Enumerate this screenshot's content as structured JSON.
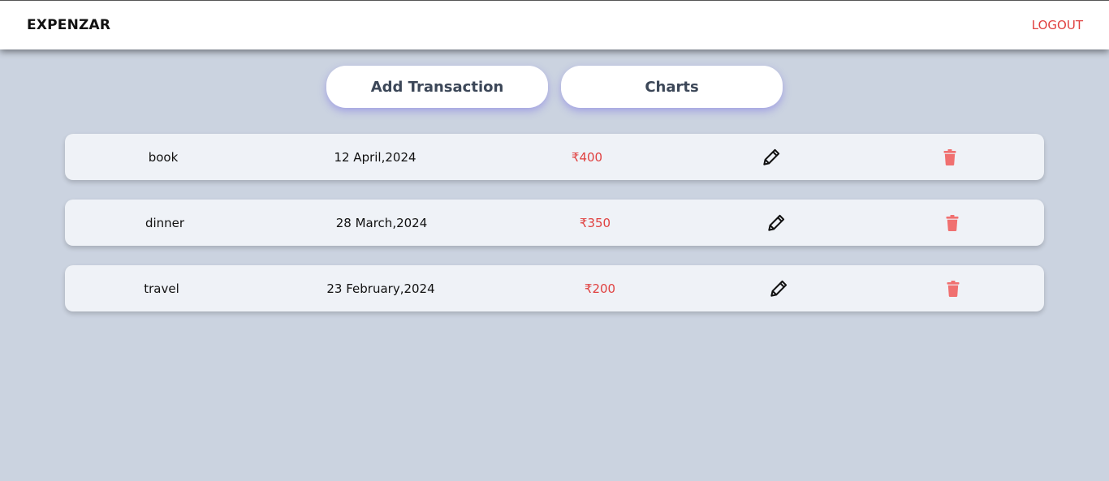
{
  "app": {
    "brand": "EXPENZAR",
    "logout_label": "LOGOUT"
  },
  "actions": {
    "add_label": "Add Transaction",
    "charts_label": "Charts"
  },
  "transactions": [
    {
      "name": "book",
      "date": "12 April,2024",
      "amount": "₹400",
      "edit_icon": "pencil-icon",
      "delete_icon": "trash-icon"
    },
    {
      "name": "dinner",
      "date": "28 March,2024",
      "amount": "₹350",
      "edit_icon": "pencil-icon",
      "delete_icon": "trash-icon"
    },
    {
      "name": "travel",
      "date": "23 February,2024",
      "amount": "₹200",
      "edit_icon": "pencil-icon",
      "delete_icon": "trash-icon"
    }
  ],
  "colors": {
    "background": "#cbd3e0",
    "row_background": "#eff2f7",
    "accent_red": "#e0403f",
    "trash_red": "#f07070",
    "button_text": "#3c4758"
  }
}
